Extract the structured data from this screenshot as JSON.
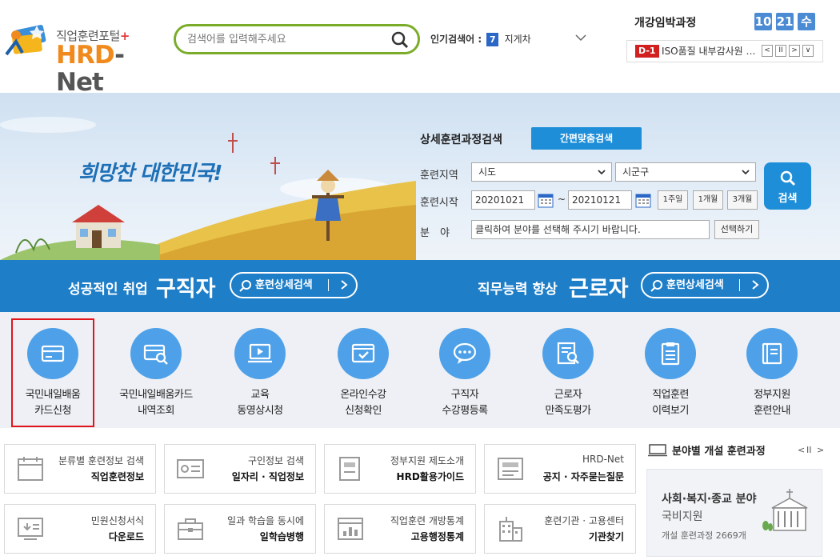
{
  "header": {
    "logo_sub": "직업훈련포털",
    "logo_plus": "+",
    "logo_hrd": "HRD",
    "logo_net": "-Net",
    "search_placeholder": "검색어를 입력해주세요",
    "popular_label": "인기검색어 :",
    "popular_rank": "7",
    "popular_keyword": "지게차",
    "upcoming_title": "개강임박과정",
    "date_month": "10",
    "date_day": "21",
    "date_weekday": "수",
    "upcoming_badge": "D-1",
    "upcoming_text": "ISO품질 내부감사원 …",
    "controls": [
      "<",
      "II",
      ">",
      "∨"
    ]
  },
  "hero": {
    "slogan": "희망찬 대한민국!",
    "detail_title": "상세훈련과정검색",
    "quick_button": "간편맞춤검색",
    "region_label": "훈련지역",
    "region_select": "시도",
    "district_select": "시군구",
    "start_label": "훈련시작",
    "date_from": "20201021",
    "date_sep": "~",
    "date_to": "20210121",
    "period_buttons": [
      "1주일",
      "1개월",
      "3개월"
    ],
    "field_label": "분　야",
    "field_placeholder": "클릭하여 분야를 선택해 주시기 바랍니다.",
    "select_button": "선택하기",
    "search_button": "검색"
  },
  "band": {
    "jobseeker_lead": "성공적인 취업",
    "jobseeker_big": "구직자",
    "jobseeker_pill": "훈련상세검색",
    "worker_lead": "직무능력 향상",
    "worker_big": "근로자",
    "worker_pill": "훈련상세검색"
  },
  "quick_menu": [
    {
      "line1": "국민내일배움",
      "line2": "카드신청",
      "icon": "card-icon"
    },
    {
      "line1": "국민내일배움카드",
      "line2": "내역조회",
      "icon": "card-search-icon"
    },
    {
      "line1": "교육",
      "line2": "동영상시청",
      "icon": "video-icon"
    },
    {
      "line1": "온라인수강",
      "line2": "신청확인",
      "icon": "online-check-icon"
    },
    {
      "line1": "구직자",
      "line2": "수강평등록",
      "icon": "chat-bubble-icon"
    },
    {
      "line1": "근로자",
      "line2": "만족도평가",
      "icon": "document-search-icon"
    },
    {
      "line1": "직업훈련",
      "line2": "이력보기",
      "icon": "clipboard-icon"
    },
    {
      "line1": "정부지원",
      "line2": "훈련안내",
      "icon": "book-icon"
    }
  ],
  "cards": [
    {
      "sub": "분류별 훈련정보 검색",
      "main": "직업훈련정보",
      "icon": "calendar-icon"
    },
    {
      "sub": "구인정보 검색",
      "main": "일자리 · 직업정보",
      "icon": "id-card-icon"
    },
    {
      "sub": "정부지원 제도소개",
      "main": "HRD활용가이드",
      "icon": "guide-icon"
    },
    {
      "sub": "HRD-Net",
      "main": "공지 · 자주묻는질문",
      "icon": "notice-icon"
    },
    {
      "sub": "민원신청서식",
      "main": "다운로드",
      "icon": "download-icon"
    },
    {
      "sub": "일과 학습을 동시에",
      "main": "일학습병행",
      "icon": "briefcase-icon"
    },
    {
      "sub": "직업훈련 개방통계",
      "main": "고용행정통계",
      "icon": "stats-icon"
    },
    {
      "sub": "훈련기관 · 고용센터",
      "main": "기관찾기",
      "icon": "building-icon"
    }
  ],
  "side": {
    "title": "분야별 개설 훈련과정",
    "controls": [
      "<",
      "II",
      ">"
    ],
    "panel_title": "사회·복지·종교 분야",
    "panel_sub": "국비지원",
    "panel_count": "개설 훈련과정 2669개"
  },
  "colors": {
    "accent": "#1e8ed8",
    "band": "#1e7ec8",
    "circle": "#4ea1e8",
    "highlight": "#e1161c"
  }
}
